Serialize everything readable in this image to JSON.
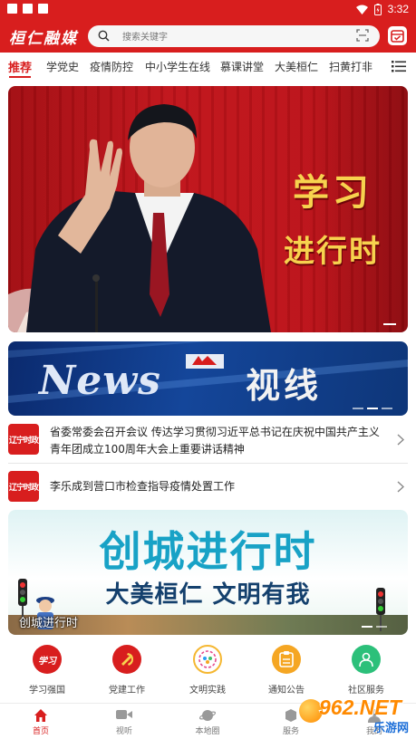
{
  "status_bar": {
    "time": "3:32"
  },
  "header": {
    "logo_text": "桓仁融媒",
    "search_placeholder": "搜索关键字"
  },
  "tabs": [
    {
      "label": "推荐",
      "active": true
    },
    {
      "label": "学党史",
      "active": false
    },
    {
      "label": "疫情防控",
      "active": false
    },
    {
      "label": "中小学生在线",
      "active": false
    },
    {
      "label": "慕课讲堂",
      "active": false
    },
    {
      "label": "大美桓仁",
      "active": false
    },
    {
      "label": "扫黄打非",
      "active": false
    }
  ],
  "banner": {
    "line1": "学习",
    "line2": "进行时"
  },
  "news_banner": {
    "english": "News",
    "chinese": "视线"
  },
  "news_items": [
    {
      "thumb_label": "辽宁时政",
      "title": "省委常委会召开会议 传达学习贯彻习近平总书记在庆祝中国共产主义青年团成立100周年大会上重要讲话精神"
    },
    {
      "thumb_label": "辽宁时政",
      "title": "李乐成到营口市检查指导疫情处置工作"
    }
  ],
  "city_banner": {
    "headline": "创城进行时",
    "slogan": "大美桓仁 文明有我",
    "caption": "创城进行时"
  },
  "quick_links": [
    {
      "label": "学习强国",
      "icon": "xuexi-qiangguo-icon",
      "color": "#d81e1e"
    },
    {
      "label": "党建工作",
      "icon": "party-emblem-icon",
      "color": "#d81e1e"
    },
    {
      "label": "文明实践",
      "icon": "civilization-practice-icon",
      "color": "#f5b731"
    },
    {
      "label": "通知公告",
      "icon": "notice-icon",
      "color": "#f5a623"
    },
    {
      "label": "社区服务",
      "icon": "community-service-icon",
      "color": "#2cc07a"
    }
  ],
  "bottom_nav": [
    {
      "label": "首页",
      "icon": "home-icon",
      "active": true
    },
    {
      "label": "视听",
      "icon": "video-icon",
      "active": false
    },
    {
      "label": "本地圈",
      "icon": "planet-icon",
      "active": false
    },
    {
      "label": "服务",
      "icon": "service-icon",
      "active": false
    },
    {
      "label": "我的",
      "icon": "user-icon",
      "active": false
    }
  ],
  "watermark": {
    "main": "962.NET",
    "sub": "乐游网"
  },
  "colors": {
    "brand_red": "#d81e1e",
    "accent_gold": "#f7d24e"
  }
}
